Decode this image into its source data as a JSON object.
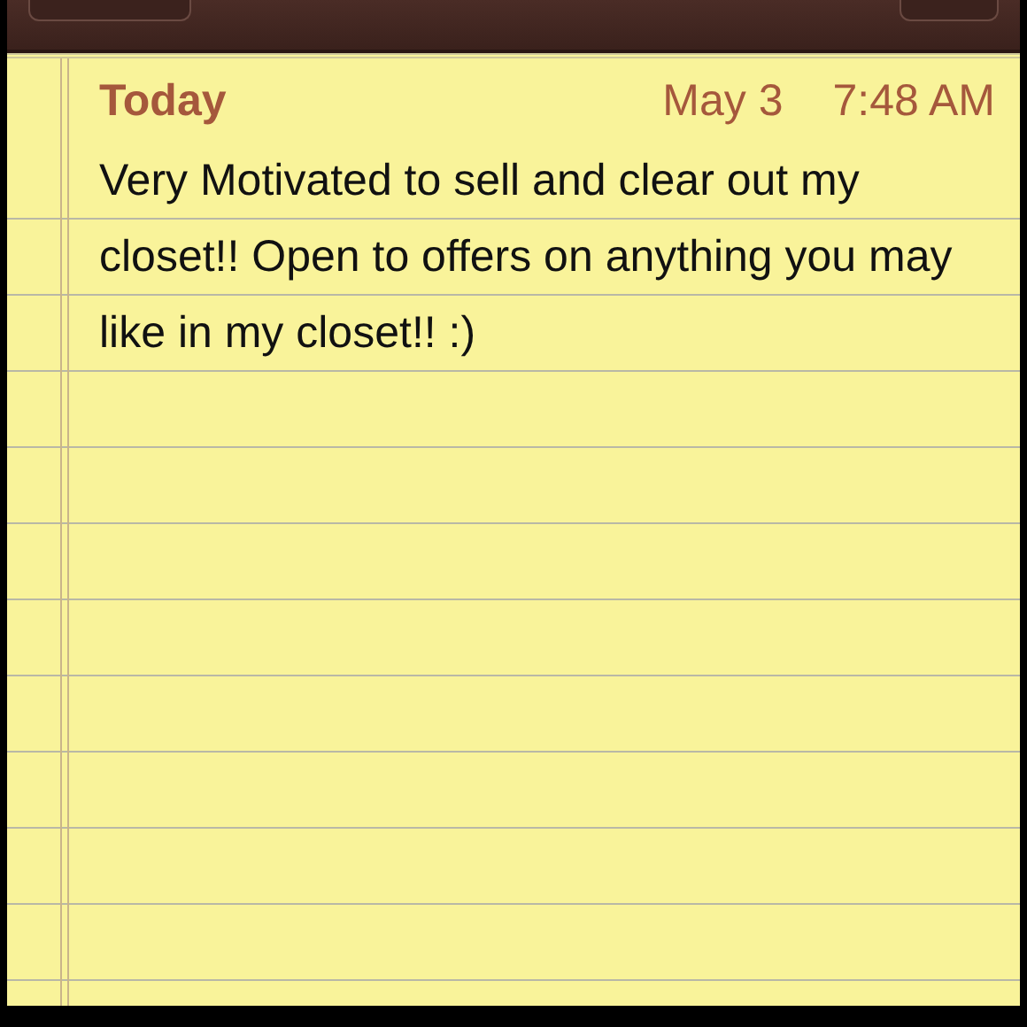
{
  "note": {
    "day": "Today",
    "date": "May 3",
    "time": "7:48 AM",
    "body": "Very Motivated to sell and clear out my closet!! Open to offers on anything you may like in my closet!! :)"
  }
}
